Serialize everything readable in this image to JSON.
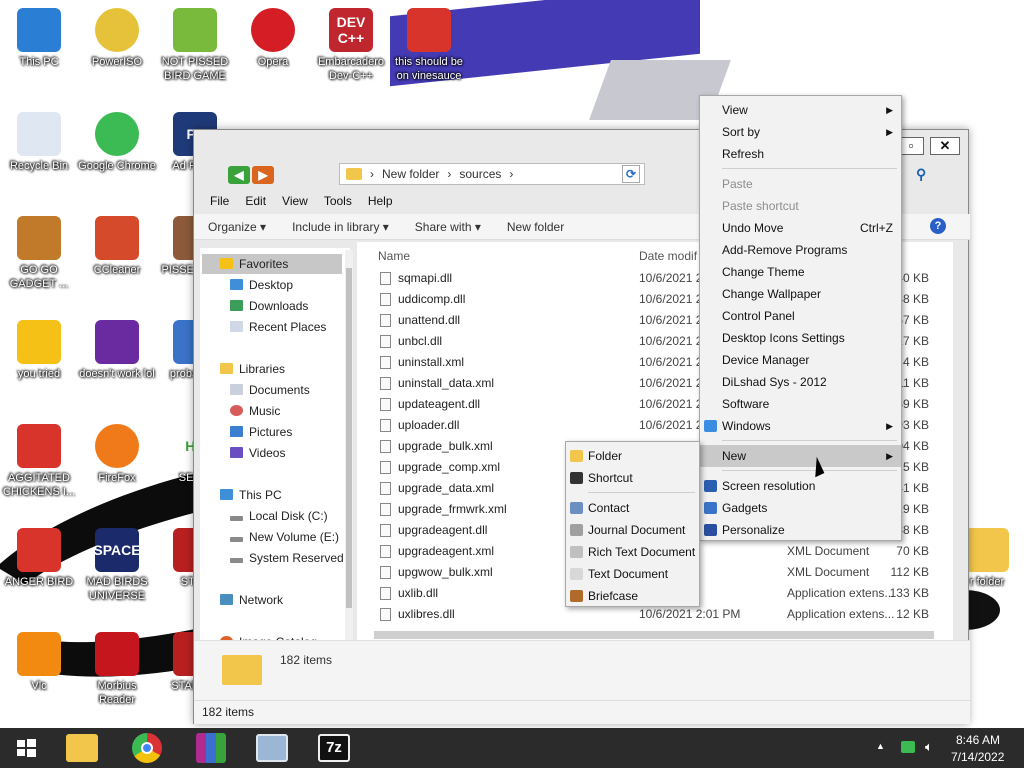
{
  "desktop_icons": [
    {
      "label": "This PC",
      "icon": "monitor-icon"
    },
    {
      "label": "PowerISO",
      "icon": "disc-icon"
    },
    {
      "label": "NOT PISSED BIRD GAME",
      "icon": "pig-icon"
    },
    {
      "label": "Opera",
      "icon": "opera-icon"
    },
    {
      "label": "Embarcadero Dev-C++",
      "icon": "devcpp-icon",
      "badge": "DEV C++"
    },
    {
      "label": "this should be on vinesauce",
      "icon": "angry-bird-icon"
    },
    {
      "label": "Recycle Bin",
      "icon": "recycle-bin-icon"
    },
    {
      "label": "Google Chrome",
      "icon": "chrome-icon"
    },
    {
      "label": "Ad Photo",
      "icon": "photoshop-icon",
      "badge": "Ps"
    },
    {
      "label": "GO GO GADGET ...",
      "icon": "briefcase-icon"
    },
    {
      "label": "CCleaner",
      "icon": "ccleaner-icon"
    },
    {
      "label": "PISSE AVIAN",
      "icon": "game-icon"
    },
    {
      "label": "you tried",
      "icon": "star-icon"
    },
    {
      "label": "doesn't work lol",
      "icon": "yahoo-icon"
    },
    {
      "label": "proba a ro",
      "icon": "app-icon"
    },
    {
      "label": "AGGITATED CHICKENS I...",
      "icon": "angry-bird-icon"
    },
    {
      "label": "FireFox",
      "icon": "firefox-icon"
    },
    {
      "label": "SEXIE",
      "icon": "hx-icon",
      "badge": "HX"
    },
    {
      "label": "ANGER BIRD",
      "icon": "angry-bird-icon"
    },
    {
      "label": "MAD BIRDS UNIVERSE",
      "icon": "angry-birds-space-icon",
      "badge": "SPACE"
    },
    {
      "label": "STAR",
      "icon": "star-wars-icon"
    },
    {
      "label": "Vlc",
      "icon": "vlc-icon"
    },
    {
      "label": "Morbius Reader",
      "icon": "acrobat-icon"
    },
    {
      "label": "STAR GA",
      "icon": "star-wars-icon"
    },
    {
      "label": "r folder",
      "icon": "folder-icon"
    }
  ],
  "explorer": {
    "address": {
      "crumbs": [
        "New folder",
        "sources"
      ]
    },
    "menu": [
      "File",
      "Edit",
      "View",
      "Tools",
      "Help"
    ],
    "commands": [
      "Organize",
      "Include in library",
      "Share with",
      "New folder"
    ],
    "nav": [
      {
        "label": "Favorites",
        "icon": "star-icon"
      },
      {
        "label": "Desktop",
        "icon": "desktop-icon"
      },
      {
        "label": "Downloads",
        "icon": "download-icon"
      },
      {
        "label": "Recent Places",
        "icon": "recent-places-icon"
      },
      {
        "label": "Libraries",
        "icon": "library-icon"
      },
      {
        "label": "Documents",
        "icon": "documents-icon"
      },
      {
        "label": "Music",
        "icon": "music-icon"
      },
      {
        "label": "Pictures",
        "icon": "pictures-icon"
      },
      {
        "label": "Videos",
        "icon": "videos-icon"
      },
      {
        "label": "This PC",
        "icon": "pc-icon"
      },
      {
        "label": "Local Disk (C:)",
        "icon": "drive-icon"
      },
      {
        "label": "New Volume (E:)",
        "icon": "drive-icon"
      },
      {
        "label": "System Reserved",
        "icon": "drive-icon"
      },
      {
        "label": "Network",
        "icon": "network-icon"
      },
      {
        "label": "Image Catalog",
        "icon": "image-catalog-icon"
      }
    ],
    "columns": {
      "name": "Name",
      "date": "Date modif"
    },
    "files": [
      {
        "name": "sqmapi.dll",
        "date": "10/6/2021 2",
        "type": "",
        "size": "40 KB"
      },
      {
        "name": "uddicomp.dll",
        "date": "10/6/2021 2",
        "type": "",
        "size": "48 KB"
      },
      {
        "name": "unattend.dll",
        "date": "10/6/2021 2",
        "type": "",
        "size": "157 KB"
      },
      {
        "name": "unbcl.dll",
        "date": "10/6/2021 2",
        "type": "",
        "size": "817 KB"
      },
      {
        "name": "uninstall.xml",
        "date": "10/6/2021 2",
        "type": "",
        "size": "4 KB"
      },
      {
        "name": "uninstall_data.xml",
        "date": "10/6/2021 2",
        "type": "",
        "size": "11 KB"
      },
      {
        "name": "updateagent.dll",
        "date": "10/6/2021 2",
        "type": "",
        "size": "2,069 KB"
      },
      {
        "name": "uploader.dll",
        "date": "10/6/2021 2",
        "type": "",
        "size": "93 KB"
      },
      {
        "name": "upgrade_bulk.xml",
        "date": "",
        "type": "",
        "size": "204 KB"
      },
      {
        "name": "upgrade_comp.xml",
        "date": "",
        "type": "",
        "size": "5 KB"
      },
      {
        "name": "upgrade_data.xml",
        "date": "",
        "type": "",
        "size": "41 KB"
      },
      {
        "name": "upgrade_frmwrk.xml",
        "date": "",
        "type": "",
        "size": "19 KB"
      },
      {
        "name": "upgradeagent.dll",
        "date": "",
        "type": "",
        "size": "2,338 KB"
      },
      {
        "name": "upgradeagent.xml",
        "date": "01 PM",
        "type": "XML Document",
        "size": "70 KB"
      },
      {
        "name": "upgwow_bulk.xml",
        "date": "01 PM",
        "type": "XML Document",
        "size": "112 KB"
      },
      {
        "name": "uxlib.dll",
        "date": "01 PM",
        "type": "Application extens...",
        "size": "133 KB"
      },
      {
        "name": "uxlibres.dll",
        "date": "10/6/2021 2:01 PM",
        "type": "Application extens...",
        "size": "12 KB"
      }
    ],
    "details_count": "182 items",
    "status_count": "182 items"
  },
  "context_menu": [
    {
      "label": "View",
      "arrow": "▶"
    },
    {
      "label": "Sort by",
      "arrow": "▶"
    },
    {
      "label": "Refresh"
    },
    {
      "sep": true
    },
    {
      "label": "Paste",
      "disabled": true
    },
    {
      "label": "Paste shortcut",
      "disabled": true
    },
    {
      "label": "Undo Move",
      "shortcut": "Ctrl+Z"
    },
    {
      "label": "Add-Remove Programs"
    },
    {
      "label": "Change Theme"
    },
    {
      "label": "Change Wallpaper"
    },
    {
      "label": "Control Panel"
    },
    {
      "label": "Desktop Icons Settings"
    },
    {
      "label": "Device Manager"
    },
    {
      "label": "DiLshad Sys - 2012"
    },
    {
      "label": "Software"
    },
    {
      "label": "Windows",
      "arrow": "▶",
      "icon": "windows-logo-icon"
    },
    {
      "sep": true
    },
    {
      "label": "New",
      "arrow": "▶",
      "highlight": true
    },
    {
      "sep": true
    },
    {
      "label": "Screen resolution",
      "icon": "screen-resolution-icon"
    },
    {
      "label": "Gadgets",
      "icon": "gadgets-icon"
    },
    {
      "label": "Personalize",
      "icon": "personalize-icon"
    }
  ],
  "submenu_new": [
    {
      "label": "Folder",
      "icon": "folder-icon"
    },
    {
      "label": "Shortcut",
      "icon": "shortcut-icon"
    },
    {
      "sep": true
    },
    {
      "label": "Contact",
      "icon": "contact-icon"
    },
    {
      "label": "Journal Document",
      "icon": "journal-icon"
    },
    {
      "label": "Rich Text Document",
      "icon": "rich-text-icon"
    },
    {
      "label": "Text Document",
      "icon": "text-document-icon"
    },
    {
      "label": "Briefcase",
      "icon": "briefcase-icon"
    }
  ],
  "taskbar": {
    "apps": [
      "windows-start-icon",
      "file-explorer-icon",
      "chrome-icon",
      "winrar-icon",
      "network-app-icon",
      "7zip-icon"
    ],
    "sevenzip_label": "7z",
    "time": "8:46 AM",
    "date": "7/14/2022"
  }
}
